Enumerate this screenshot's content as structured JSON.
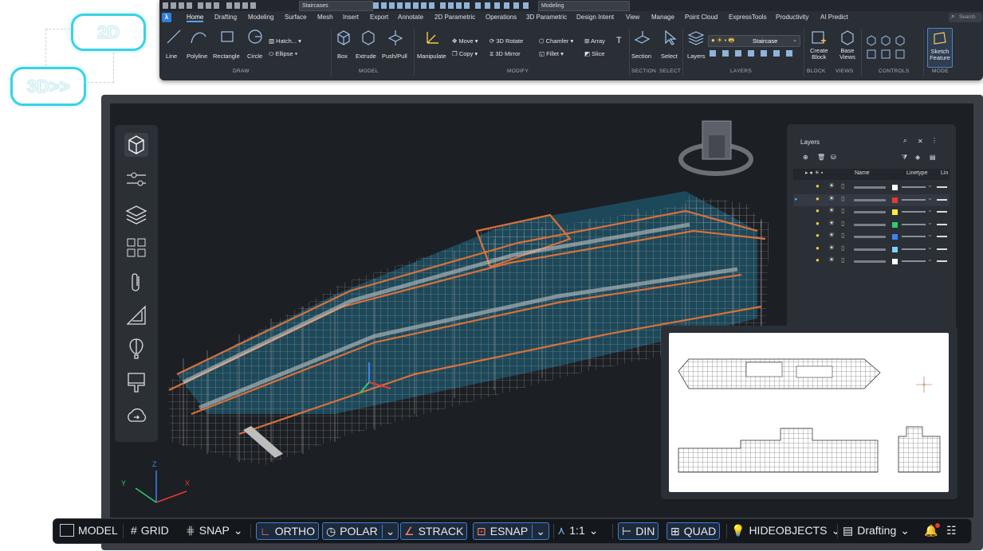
{
  "badges": {
    "two_d": "2D",
    "three_d": "3D>>"
  },
  "qat": {
    "layer_select": "Staircases",
    "workspace_select": "Modeling"
  },
  "tabs": [
    "Home",
    "Drafting",
    "Modeling",
    "Surface",
    "Mesh",
    "Insert",
    "Export",
    "Annotate",
    "2D Parametric",
    "Operations",
    "3D Parametric",
    "Design Intent",
    "View",
    "Manage",
    "Point Cloud",
    "ExpressTools",
    "Productivity",
    "AI Predict"
  ],
  "search_placeholder": "Search",
  "ribbon": {
    "draw": {
      "label": "DRAW",
      "line": "Line",
      "polyline": "Polyline",
      "rectangle": "Rectangle",
      "circle": "Circle",
      "hatch": "Hatch...",
      "ellipse": "Ellipse"
    },
    "model": {
      "label": "MODEL",
      "box": "Box",
      "extrude": "Extrude",
      "pushpull": "Push/Pull"
    },
    "modify": {
      "label": "MODIFY",
      "manipulate": "Manipulate",
      "move": "Move",
      "copy": "Copy",
      "rotate": "3D Rotate",
      "mirror": "3D Mirror",
      "chamfer": "Chamfer",
      "fillet": "Fillet",
      "array": "Array",
      "slice": "Slice"
    },
    "section": {
      "label": "SECTION",
      "btn": "Section"
    },
    "select": {
      "label": "SELECT",
      "btn": "Select"
    },
    "layers": {
      "label": "LAYERS",
      "btn": "Layers",
      "current": "Staircase"
    },
    "block": {
      "label": "BLOCK",
      "create": "Create",
      "create2": "Block"
    },
    "views": {
      "label": "VIEWS",
      "base": "Base",
      "base2": "Views"
    },
    "controls": {
      "label": "CONTROLS"
    },
    "mode": {
      "label": "MODE",
      "sketch": "Sketch",
      "feature": "Feature"
    }
  },
  "layers_panel": {
    "title": "Layers",
    "col_name": "Name",
    "col_linetype": "Linetype",
    "col_lin": "Lin",
    "rows": [
      {
        "color": "#ffffff",
        "current": false
      },
      {
        "color": "#e53935",
        "current": true
      },
      {
        "color": "#ffeb3b",
        "current": false
      },
      {
        "color": "#2ecc71",
        "current": false
      },
      {
        "color": "#3b82f6",
        "current": false
      },
      {
        "color": "#7dd3fc",
        "current": false
      },
      {
        "color": "#ffffff",
        "current": false
      }
    ]
  },
  "axes": {
    "x": "X",
    "y": "Y",
    "z": "Z"
  },
  "status": {
    "model": "MODEL",
    "grid": "GRID",
    "snap": "SNAP",
    "ortho": "ORTHO",
    "polar": "POLAR",
    "strack": "STRACK",
    "esnap": "ESNAP",
    "scale": "1:1",
    "din": "DIN",
    "quad": "QUAD",
    "hideobjects": "HIDEOBJECTS",
    "workspace": "Drafting"
  },
  "colors": {
    "accent": "#37d3e6",
    "hull": "#1e4a5c",
    "scaffold": "#c9c9c9",
    "deck": "#d76b34"
  }
}
